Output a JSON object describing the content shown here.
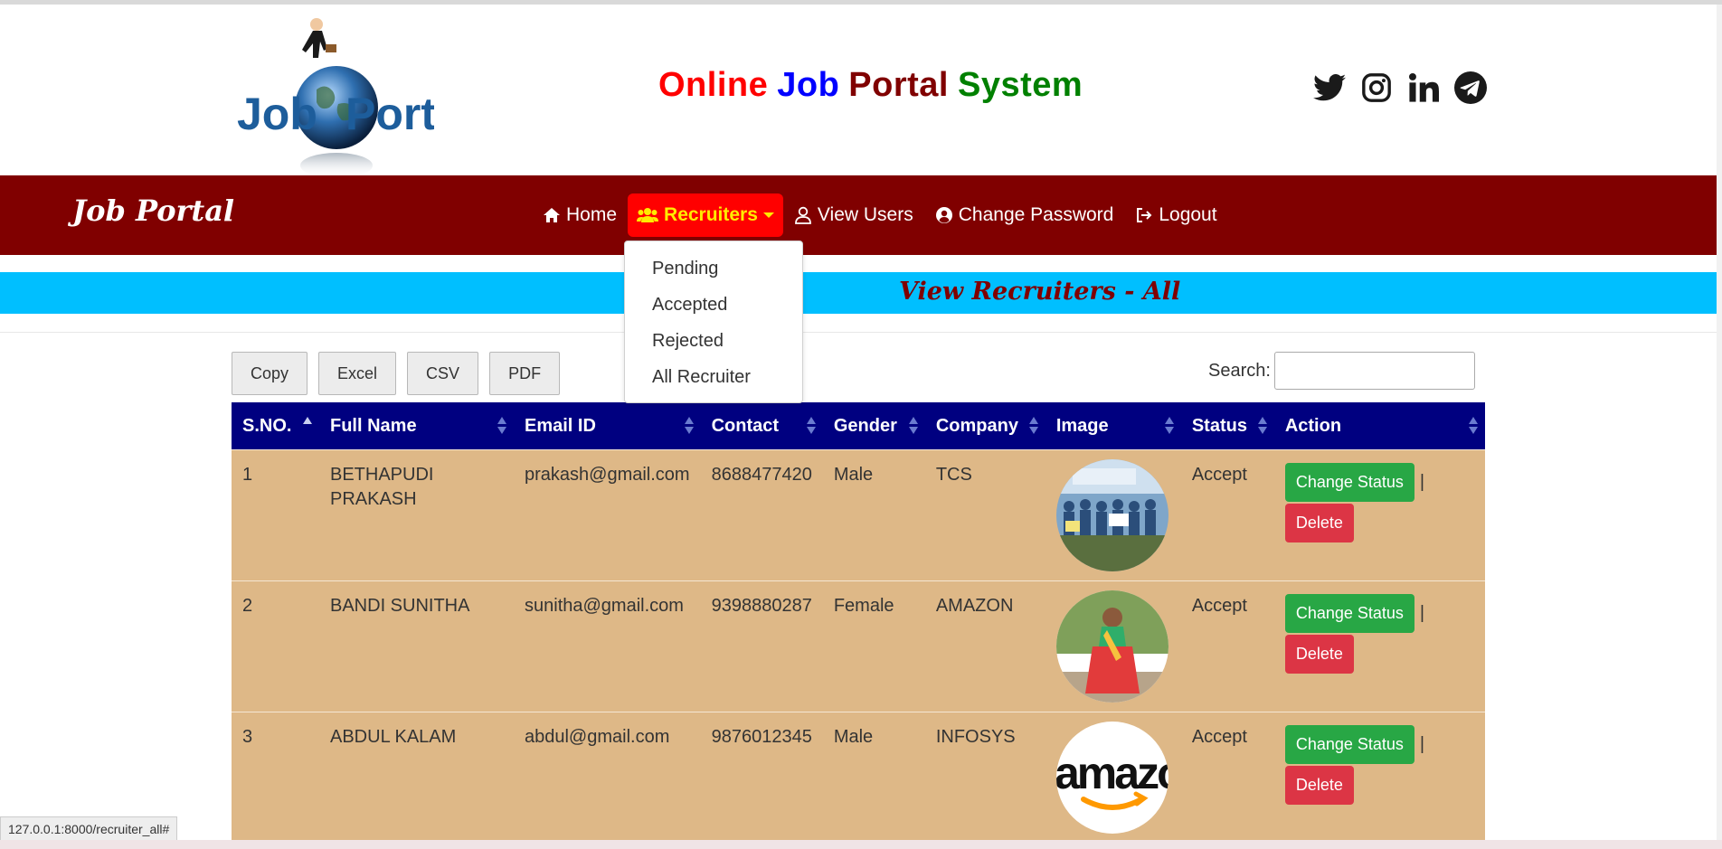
{
  "header": {
    "logo_text": "Job Portal",
    "title_parts": [
      {
        "text": "Online",
        "color": "#ff0000"
      },
      {
        "text": "Job",
        "color": "#0000ff"
      },
      {
        "text": "Portal",
        "color": "#800000"
      },
      {
        "text": "System",
        "color": "#008000"
      }
    ],
    "social_icons": [
      "twitter-icon",
      "instagram-icon",
      "linkedin-icon",
      "telegram-icon"
    ]
  },
  "navbar": {
    "brand": "Job Portal",
    "items": [
      {
        "label": "Home",
        "icon": "home-icon"
      },
      {
        "label": "Recruiters",
        "icon": "users-icon",
        "active": true
      },
      {
        "label": "View Users",
        "icon": "user-icon"
      },
      {
        "label": "Change Password",
        "icon": "user-circle-icon"
      },
      {
        "label": "Logout",
        "icon": "logout-icon"
      }
    ],
    "dropdown": [
      "Pending",
      "Accepted",
      "Rejected",
      "All Recruiter"
    ]
  },
  "banner": {
    "title": "View Recruiters - All"
  },
  "toolbar": {
    "buttons": [
      "Copy",
      "Excel",
      "CSV",
      "PDF"
    ],
    "search_label": "Search:",
    "search_value": ""
  },
  "table": {
    "columns": [
      "S.NO.",
      "Full Name",
      "Email ID",
      "Contact",
      "Gender",
      "Company",
      "Image",
      "Status",
      "Action"
    ],
    "rows": [
      {
        "sno": "1",
        "name": "BETHAPUDI PRAKASH",
        "email": "prakash@gmail.com",
        "contact": "8688477420",
        "gender": "Male",
        "company": "TCS",
        "image": "group-photo",
        "status": "Accept"
      },
      {
        "sno": "2",
        "name": "BANDI SUNITHA",
        "email": "sunitha@gmail.com",
        "contact": "9398880287",
        "gender": "Female",
        "company": "AMAZON",
        "image": "woman-photo",
        "status": "Accept"
      },
      {
        "sno": "3",
        "name": "ABDUL KALAM",
        "email": "abdul@gmail.com",
        "contact": "9876012345",
        "gender": "Male",
        "company": "INFOSYS",
        "image": "amazon-logo",
        "status": "Accept"
      }
    ],
    "action_change": "Change Status",
    "action_separator": "|",
    "action_delete": "Delete"
  },
  "statusbar": {
    "url": "127.0.0.1:8000/recruiter_all#"
  },
  "colors": {
    "navbar": "#800000",
    "active_nav_bg": "#ff0000",
    "active_nav_text": "#ffeb00",
    "banner": "#00bfff",
    "table_header": "#000080",
    "row_bg": "#deb887",
    "btn_green": "#28a745",
    "btn_red": "#dc3545"
  }
}
